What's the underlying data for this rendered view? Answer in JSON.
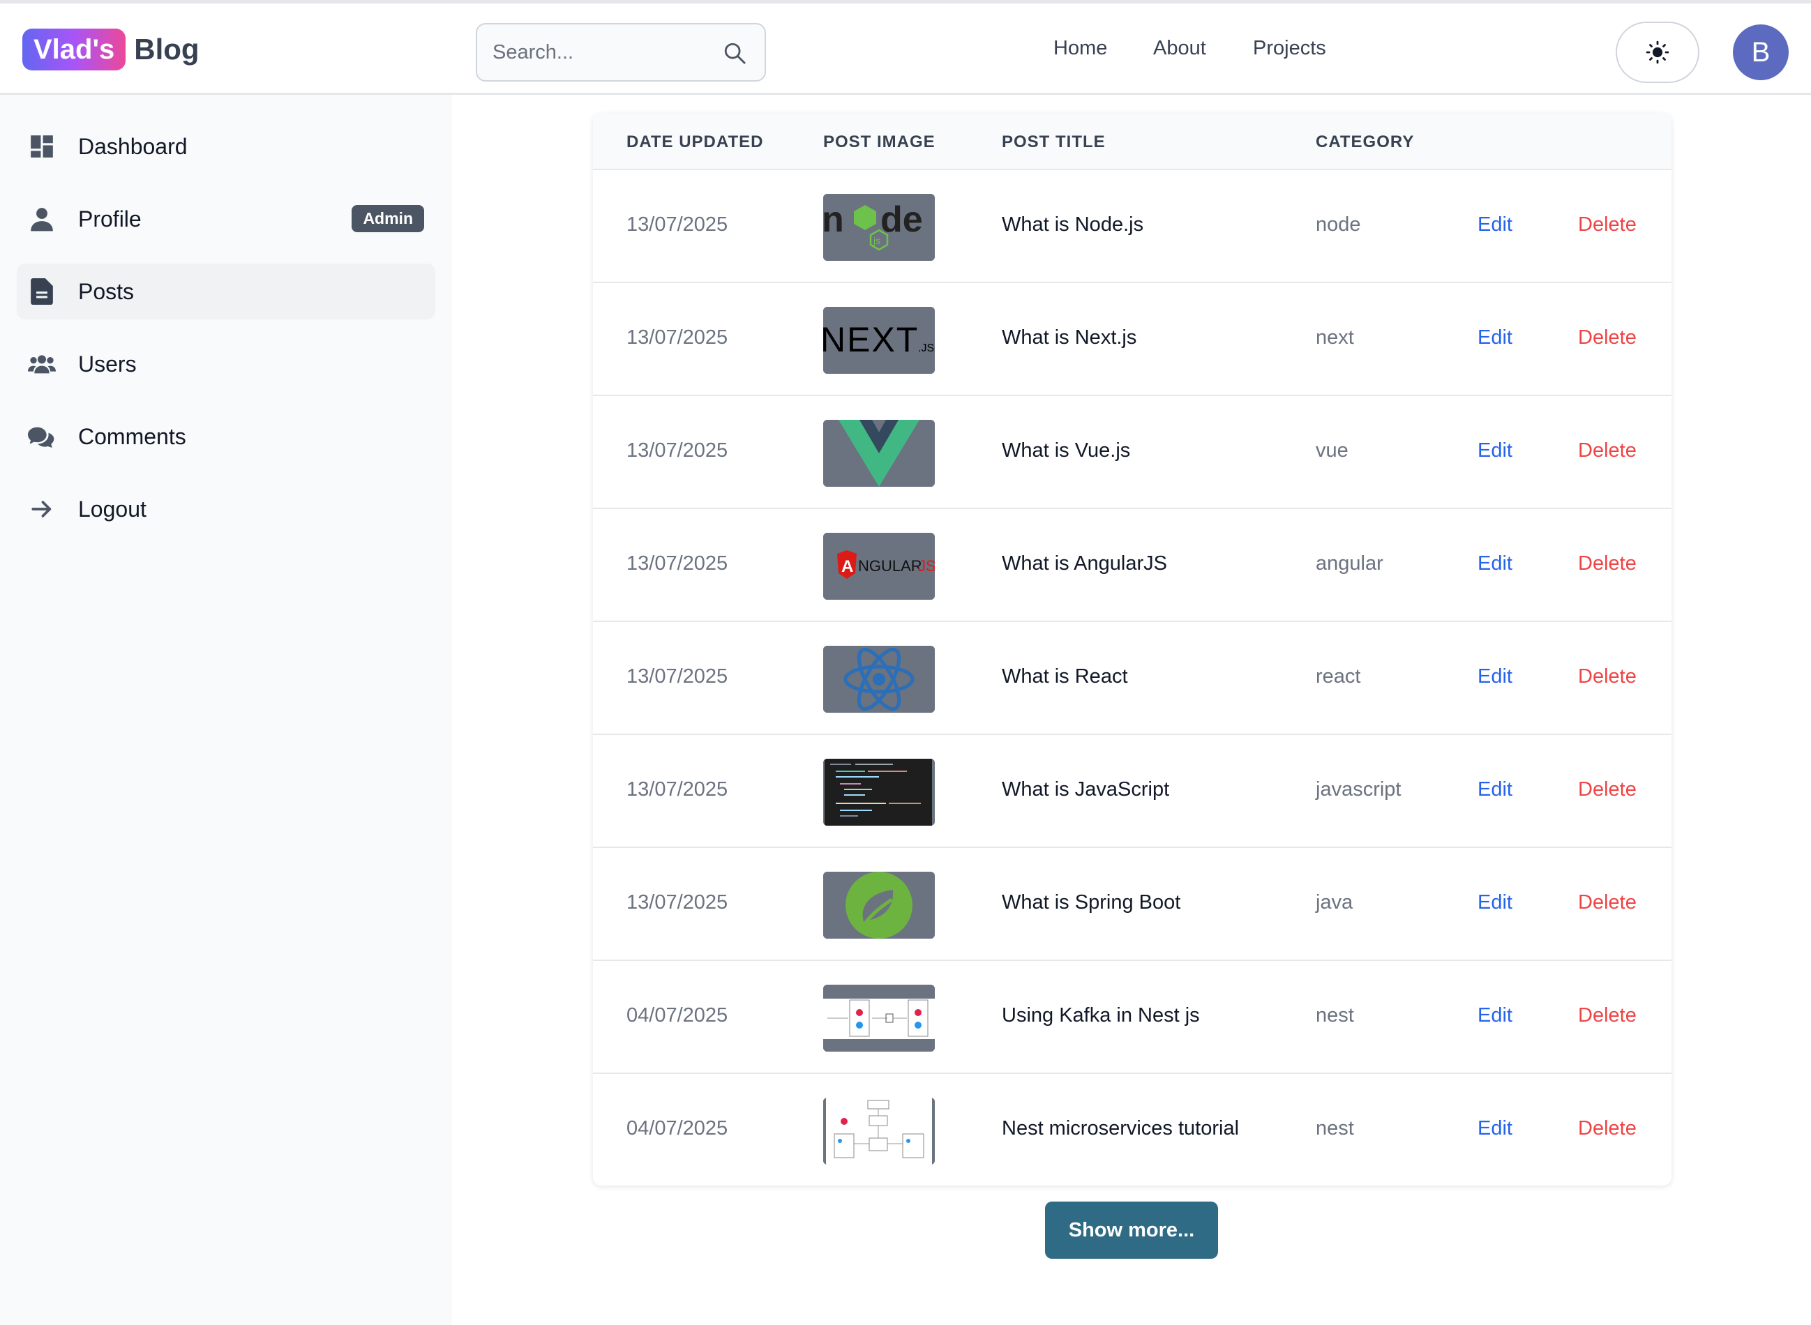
{
  "header": {
    "brand_badge": "Vlad's",
    "brand_text": "Blog",
    "search_placeholder": "Search...",
    "nav": [
      "Home",
      "About",
      "Projects"
    ],
    "avatar_initial": "B"
  },
  "sidebar": {
    "items": [
      {
        "label": "Dashboard",
        "icon": "dashboard-icon"
      },
      {
        "label": "Profile",
        "icon": "user-icon",
        "badge": "Admin"
      },
      {
        "label": "Posts",
        "icon": "document-icon",
        "active": true
      },
      {
        "label": "Users",
        "icon": "users-icon"
      },
      {
        "label": "Comments",
        "icon": "comments-icon"
      },
      {
        "label": "Logout",
        "icon": "arrow-right-icon"
      }
    ]
  },
  "table": {
    "headers": [
      "DATE UPDATED",
      "POST IMAGE",
      "POST TITLE",
      "CATEGORY"
    ],
    "rows": [
      {
        "date": "13/07/2025",
        "image": "node-js-logo",
        "title": "What is Node.js",
        "category": "node",
        "edit": "Edit",
        "delete": "Delete"
      },
      {
        "date": "13/07/2025",
        "image": "next-js-logo",
        "title": "What is Next.js",
        "category": "next",
        "edit": "Edit",
        "delete": "Delete"
      },
      {
        "date": "13/07/2025",
        "image": "vue-js-logo",
        "title": "What is Vue.js",
        "category": "vue",
        "edit": "Edit",
        "delete": "Delete"
      },
      {
        "date": "13/07/2025",
        "image": "angularjs-logo",
        "title": "What is AngularJS",
        "category": "angular",
        "edit": "Edit",
        "delete": "Delete"
      },
      {
        "date": "13/07/2025",
        "image": "react-logo",
        "title": "What is React",
        "category": "react",
        "edit": "Edit",
        "delete": "Delete"
      },
      {
        "date": "13/07/2025",
        "image": "javascript-code-screenshot",
        "title": "What is JavaScript",
        "category": "javascript",
        "edit": "Edit",
        "delete": "Delete"
      },
      {
        "date": "13/07/2025",
        "image": "spring-boot-logo",
        "title": "What is Spring Boot",
        "category": "java",
        "edit": "Edit",
        "delete": "Delete"
      },
      {
        "date": "04/07/2025",
        "image": "kafka-nest-diagram",
        "title": "Using Kafka in Nest js",
        "category": "nest",
        "edit": "Edit",
        "delete": "Delete"
      },
      {
        "date": "04/07/2025",
        "image": "nest-microservices-diagram",
        "title": "Nest microservices tutorial",
        "category": "nest",
        "edit": "Edit",
        "delete": "Delete"
      }
    ]
  },
  "show_more": "Show more...",
  "colors": {
    "accent_blue": "#2563eb",
    "delete_red": "#ef4444",
    "show_more_bg": "#2f6b84",
    "avatar_bg": "#5c6bc0",
    "badge_bg": "#4b5563"
  }
}
